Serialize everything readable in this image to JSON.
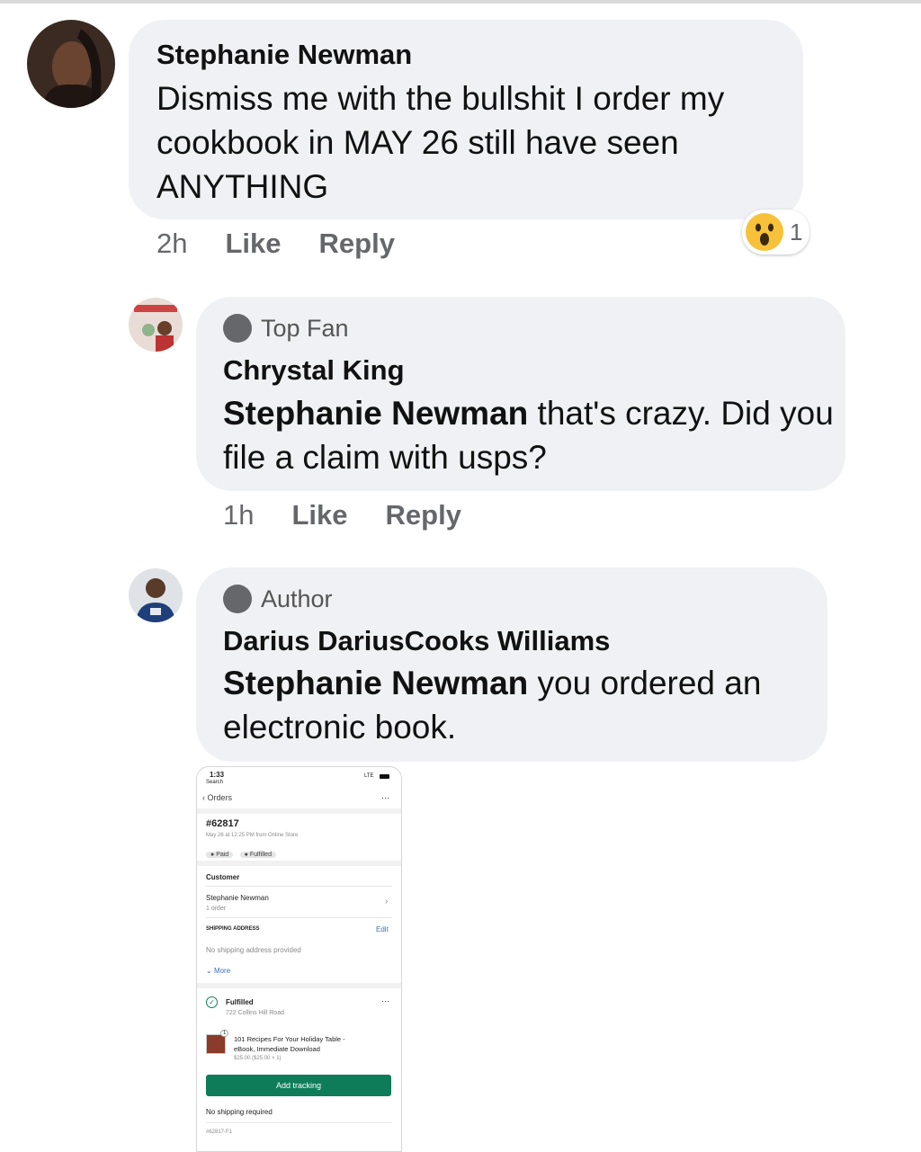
{
  "comments": [
    {
      "author": "Stephanie Newman",
      "text": "Dismiss me with the bullshit I order my cookbook in MAY 26 still have seen ANYTHING",
      "time": "2h",
      "like": "Like",
      "reply": "Reply",
      "reaction_count": "1"
    },
    {
      "badge": "Top Fan",
      "author": "Chrystal King",
      "mention": "Stephanie Newman",
      "text": " that's crazy. Did you file a claim with usps?",
      "time": "1h",
      "like": "Like",
      "reply": "Reply"
    },
    {
      "badge": "Author",
      "author": "Darius DariusCooks Williams",
      "mention": "Stephanie Newman",
      "text": " you ordered an electronic book."
    }
  ],
  "screenshot": {
    "status_time": "1:33",
    "status_back": "Search",
    "status_network": "LTE",
    "back_label": "Orders",
    "more": "···",
    "order_number": "#62817",
    "order_meta": "May 26 at 12:25 PM from Online Store",
    "pill_paid": "Paid",
    "pill_fulfilled": "Fulfilled",
    "customer_heading": "Customer",
    "customer_name": "Stephanie Newman",
    "customer_orders": "1 order",
    "shipping_heading": "SHIPPING ADDRESS",
    "edit": "Edit",
    "no_shipping": "No shipping address provided",
    "more_link": "More",
    "fulfilled_title": "Fulfilled",
    "fulfilled_address": "722 Collins Hill Road",
    "item_qty": "1",
    "item_title_1": "101 Recipes For Your Holiday Table -",
    "item_title_2": "eBook, Immediate Download",
    "item_price": "$25.00  ($25.00 × 1)",
    "add_tracking": "Add tracking",
    "no_shipping_required": "No shipping required",
    "fulfillment_id": "#62817-F1"
  },
  "colors": {
    "bubble": "#f0f1f4",
    "meta": "#65676b",
    "tracking_button": "#0e7c59"
  }
}
